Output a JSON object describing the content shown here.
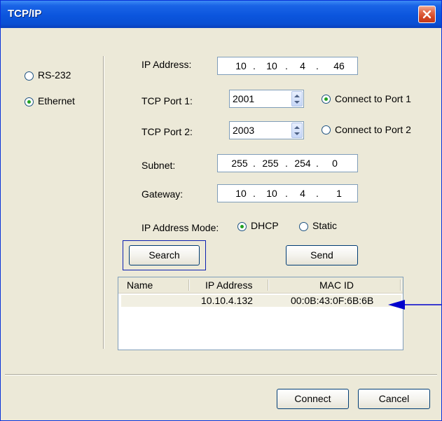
{
  "window": {
    "title": "TCP/IP"
  },
  "connection_type": {
    "options": [
      {
        "label": "RS-232",
        "selected": false
      },
      {
        "label": "Ethernet",
        "selected": true
      }
    ]
  },
  "ip_address": {
    "label": "IP Address:",
    "octets": [
      "10",
      "10",
      "4",
      "46"
    ]
  },
  "tcp_port_1": {
    "label": "TCP Port 1:",
    "value": "2001",
    "connect_label": "Connect to Port 1",
    "connect_selected": true
  },
  "tcp_port_2": {
    "label": "TCP Port 2:",
    "value": "2003",
    "connect_label": "Connect to Port 2",
    "connect_selected": false
  },
  "subnet": {
    "label": "Subnet:",
    "octets": [
      "255",
      "255",
      "254",
      "0"
    ]
  },
  "gateway": {
    "label": "Gateway:",
    "octets": [
      "10",
      "10",
      "4",
      "1"
    ]
  },
  "ip_mode": {
    "label": "IP Address Mode:",
    "options": [
      {
        "label": "DHCP",
        "selected": true
      },
      {
        "label": "Static",
        "selected": false
      }
    ]
  },
  "buttons": {
    "search": "Search",
    "send": "Send",
    "connect": "Connect",
    "cancel": "Cancel"
  },
  "device_list": {
    "columns": [
      "Name",
      "IP Address",
      "MAC ID"
    ],
    "rows": [
      {
        "name": "",
        "ip": "10.10.4.132",
        "mac": "00:0B:43:0F:6B:6B"
      }
    ]
  },
  "colors": {
    "title_bar": "#0a4fd3",
    "dialog_bg": "#ece9d8",
    "annotation_arrow": "#0000cc",
    "radio_dot": "#21a121"
  }
}
